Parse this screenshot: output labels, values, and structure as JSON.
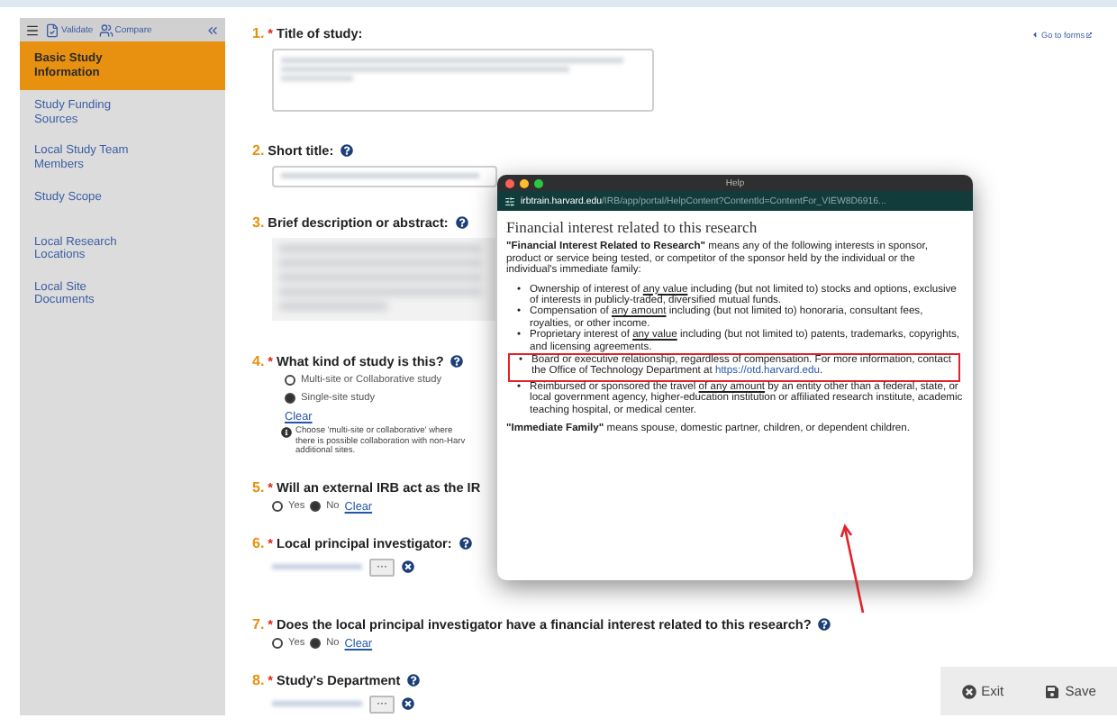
{
  "sidebar": {
    "toolbar": [
      {
        "kind": "menu"
      },
      {
        "kind": "validate",
        "label": "Validate"
      },
      {
        "kind": "compare",
        "label": "Compare"
      },
      {
        "kind": "collapse"
      }
    ],
    "items": [
      {
        "label": "Basic Study Information",
        "selected": true
      },
      {
        "label": "Study Funding Sources",
        "selected": false
      },
      {
        "label": "Local Study Team Members",
        "selected": false
      },
      {
        "label": "Study Scope",
        "selected": false
      },
      {
        "label": "Local Research Locations",
        "selected": false
      },
      {
        "label": "Local Site Documents",
        "selected": false
      }
    ]
  },
  "go_to_forms": "Go to forms",
  "questions": [
    {
      "number": "1.",
      "required_mark": "*",
      "label": "Title of study:",
      "help": false,
      "kind": "textarea"
    },
    {
      "number": "2.",
      "label": "Short title:",
      "help": true,
      "kind": "input"
    },
    {
      "number": "3.",
      "label": "Brief description or abstract:",
      "help": true,
      "kind": "abstract"
    },
    {
      "number": "4.",
      "required_mark": "*",
      "label": "What kind of study is this?",
      "help": true,
      "kind": "radio_list",
      "options": [
        {
          "label": "Multi-site or Collaborative study",
          "selected": false
        },
        {
          "label": "Single-site study",
          "selected": true
        }
      ],
      "clear": "Clear",
      "info_lines": [
        "Choose 'multi-site or collaborative' where",
        "there is possible collaboration with non-Harv",
        "additional sites."
      ]
    },
    {
      "number": "5.",
      "required_mark": "*",
      "label": "Will an external IRB act as the IR",
      "help": false,
      "kind": "radio_inline",
      "options": [
        {
          "label": "Yes",
          "selected": false
        },
        {
          "label": "No",
          "selected": true
        }
      ],
      "clear": "Clear"
    },
    {
      "number": "6.",
      "required_mark": "*",
      "label": "Local principal investigator:",
      "help": true,
      "kind": "person",
      "picker": "···"
    },
    {
      "number": "7.",
      "required_mark": "*",
      "label": "Does the local principal investigator have a financial interest related to this research?",
      "help": true,
      "kind": "radio_inline",
      "options": [
        {
          "label": "Yes",
          "selected": false
        },
        {
          "label": "No",
          "selected": true
        }
      ],
      "clear": "Clear"
    },
    {
      "number": "8.",
      "required_mark": "*",
      "label": "Study's Department",
      "help": true,
      "kind": "person",
      "picker": "···"
    }
  ],
  "help_window": {
    "title": "Help",
    "url_domain": "irbtrain.harvard.edu",
    "url_path": "/IRB/app/portal/HelpContent?ContentId=ContentFor_VIEW8D6916...",
    "heading": "Financial interest related to this research",
    "intro": "**\"Financial Interest Related to Research\"** means any of the following interests in sponsor, product or service being tested, or competitor of the sponsor held by the individual or the individual's immediate family:",
    "marker": "•",
    "bullets": [
      {
        "highlighted": false,
        "parts": [
          {
            "kind": "text",
            "text": "Ownership of interest of "
          },
          {
            "kind": "underline",
            "text": "any value"
          },
          {
            "kind": "text",
            "text": " including (but not limited to) stocks and options, exclusive of interests in publicly-traded, diversified mutual funds."
          }
        ]
      },
      {
        "highlighted": false,
        "parts": [
          {
            "kind": "text",
            "text": "Compensation of "
          },
          {
            "kind": "underline",
            "text": "any amount"
          },
          {
            "kind": "text",
            "text": " including (but not limited to) honoraria, consultant fees, royalties, or other income."
          }
        ]
      },
      {
        "highlighted": false,
        "parts": [
          {
            "kind": "text",
            "text": "Proprietary interest of "
          },
          {
            "kind": "underline",
            "text": "any value"
          },
          {
            "kind": "text",
            "text": " including (but not limited to) patents, trademarks, copyrights, and licensing agreements."
          }
        ]
      },
      {
        "highlighted": true,
        "parts": [
          {
            "kind": "text",
            "text": "Board or executive relationship, regardless of compensation. For more information, contact the Office of Technology Department at "
          },
          {
            "kind": "link",
            "text": "https://otd.harvard.edu"
          },
          {
            "kind": "text",
            "text": "."
          }
        ]
      },
      {
        "highlighted": false,
        "parts": [
          {
            "kind": "text",
            "text": "Reimbursed or sponsored the travel "
          },
          {
            "kind": "underline",
            "text": "of any amount"
          },
          {
            "kind": "text",
            "text": " by an entity other than a federal, state, or local government agency, higher-education institution or affiliated research institute, academic teaching hospital, or medical center."
          }
        ]
      }
    ],
    "footer": "**\"Immediate Family\"** means spouse, domestic partner, children, or dependent children."
  },
  "actions": [
    {
      "kind": "exit",
      "label": "Exit"
    },
    {
      "kind": "save",
      "label": "Save"
    }
  ]
}
